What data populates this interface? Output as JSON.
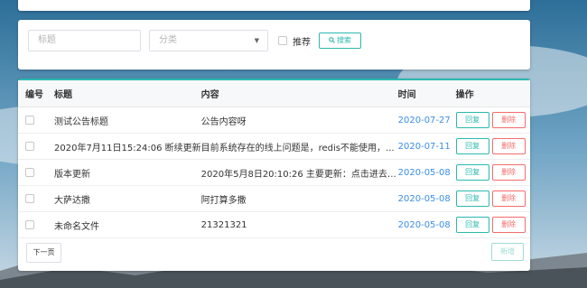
{
  "search": {
    "title_placeholder": "标题",
    "category_placeholder": "分类",
    "recommend_label": "推荐",
    "search_label": "搜索"
  },
  "table": {
    "headers": [
      "编号",
      "标题",
      "内容",
      "时间",
      "操作"
    ],
    "rows": [
      {
        "title": "测试公告标题",
        "content": "公告内容呀",
        "time": "2020-07-27"
      },
      {
        "title": "2020年7月11日15:24:06 断续更新",
        "content": "目前系统存在的线上问题是，redis不能使用，...",
        "time": "2020-07-11"
      },
      {
        "title": "版本更新",
        "content": "2020年5月8日20:10:26 主要更新：点击进去某...",
        "time": "2020-05-08"
      },
      {
        "title": "大萨达撒",
        "content": "阿打算多撒",
        "time": "2020-05-08"
      },
      {
        "title": "未命名文件",
        "content": "21321321",
        "time": "2020-05-08"
      }
    ],
    "reply_label": "回复",
    "delete_label": "删除"
  },
  "footer": {
    "next_label": "下一页",
    "add_label": "新增"
  },
  "colors": {
    "accent": "#2bb9b0",
    "danger": "#f56c6c",
    "date": "#3a8ee6"
  }
}
